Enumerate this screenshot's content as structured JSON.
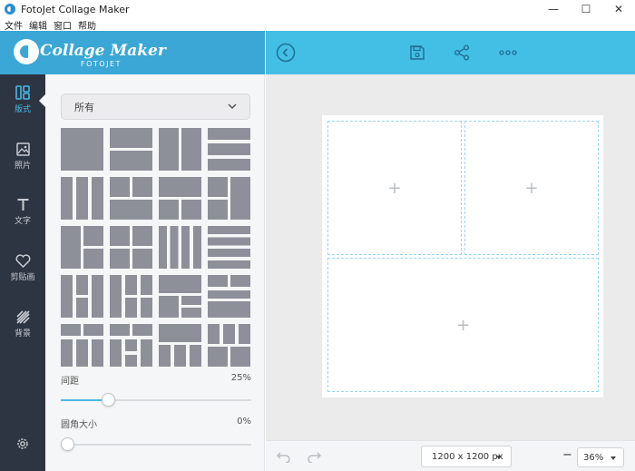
{
  "window": {
    "title": "FotoJet Collage Maker",
    "controls": {
      "minimize": "—",
      "maximize": "☐",
      "close": "✕"
    }
  },
  "menu": {
    "items": [
      "文件",
      "编辑",
      "窗口",
      "帮助"
    ]
  },
  "logo": {
    "main": "Collage Maker",
    "sub": "FOTOJET"
  },
  "nav": {
    "items": [
      {
        "label": "版式",
        "icon": "layout-icon",
        "active": true
      },
      {
        "label": "照片",
        "icon": "photo-icon",
        "active": false
      },
      {
        "label": "文字",
        "icon": "text-icon",
        "active": false
      },
      {
        "label": "剪贴画",
        "icon": "heart-icon",
        "active": false
      },
      {
        "label": "背景",
        "icon": "background-icon",
        "active": false
      }
    ],
    "settings_icon": "gear-icon"
  },
  "panel": {
    "filter_value": "所有",
    "spacing_label": "间距",
    "spacing_value": "25%",
    "spacing_level": 0.25,
    "radius_label": "圆角大小",
    "radius_value": "0%",
    "radius_level": 0
  },
  "toolbar": {
    "back_icon": "back-icon",
    "save_icon": "save-icon",
    "share_icon": "share-icon",
    "more_icon": "more-icon"
  },
  "canvas": {
    "add_glyph": "+"
  },
  "bottom": {
    "size_label": "1200 x 1200 px",
    "zoom_value": "36%",
    "zoom_out": "−"
  },
  "colors": {
    "accent": "#43bfe6",
    "nav_bg": "#2e3542",
    "template": "#8d9099"
  }
}
